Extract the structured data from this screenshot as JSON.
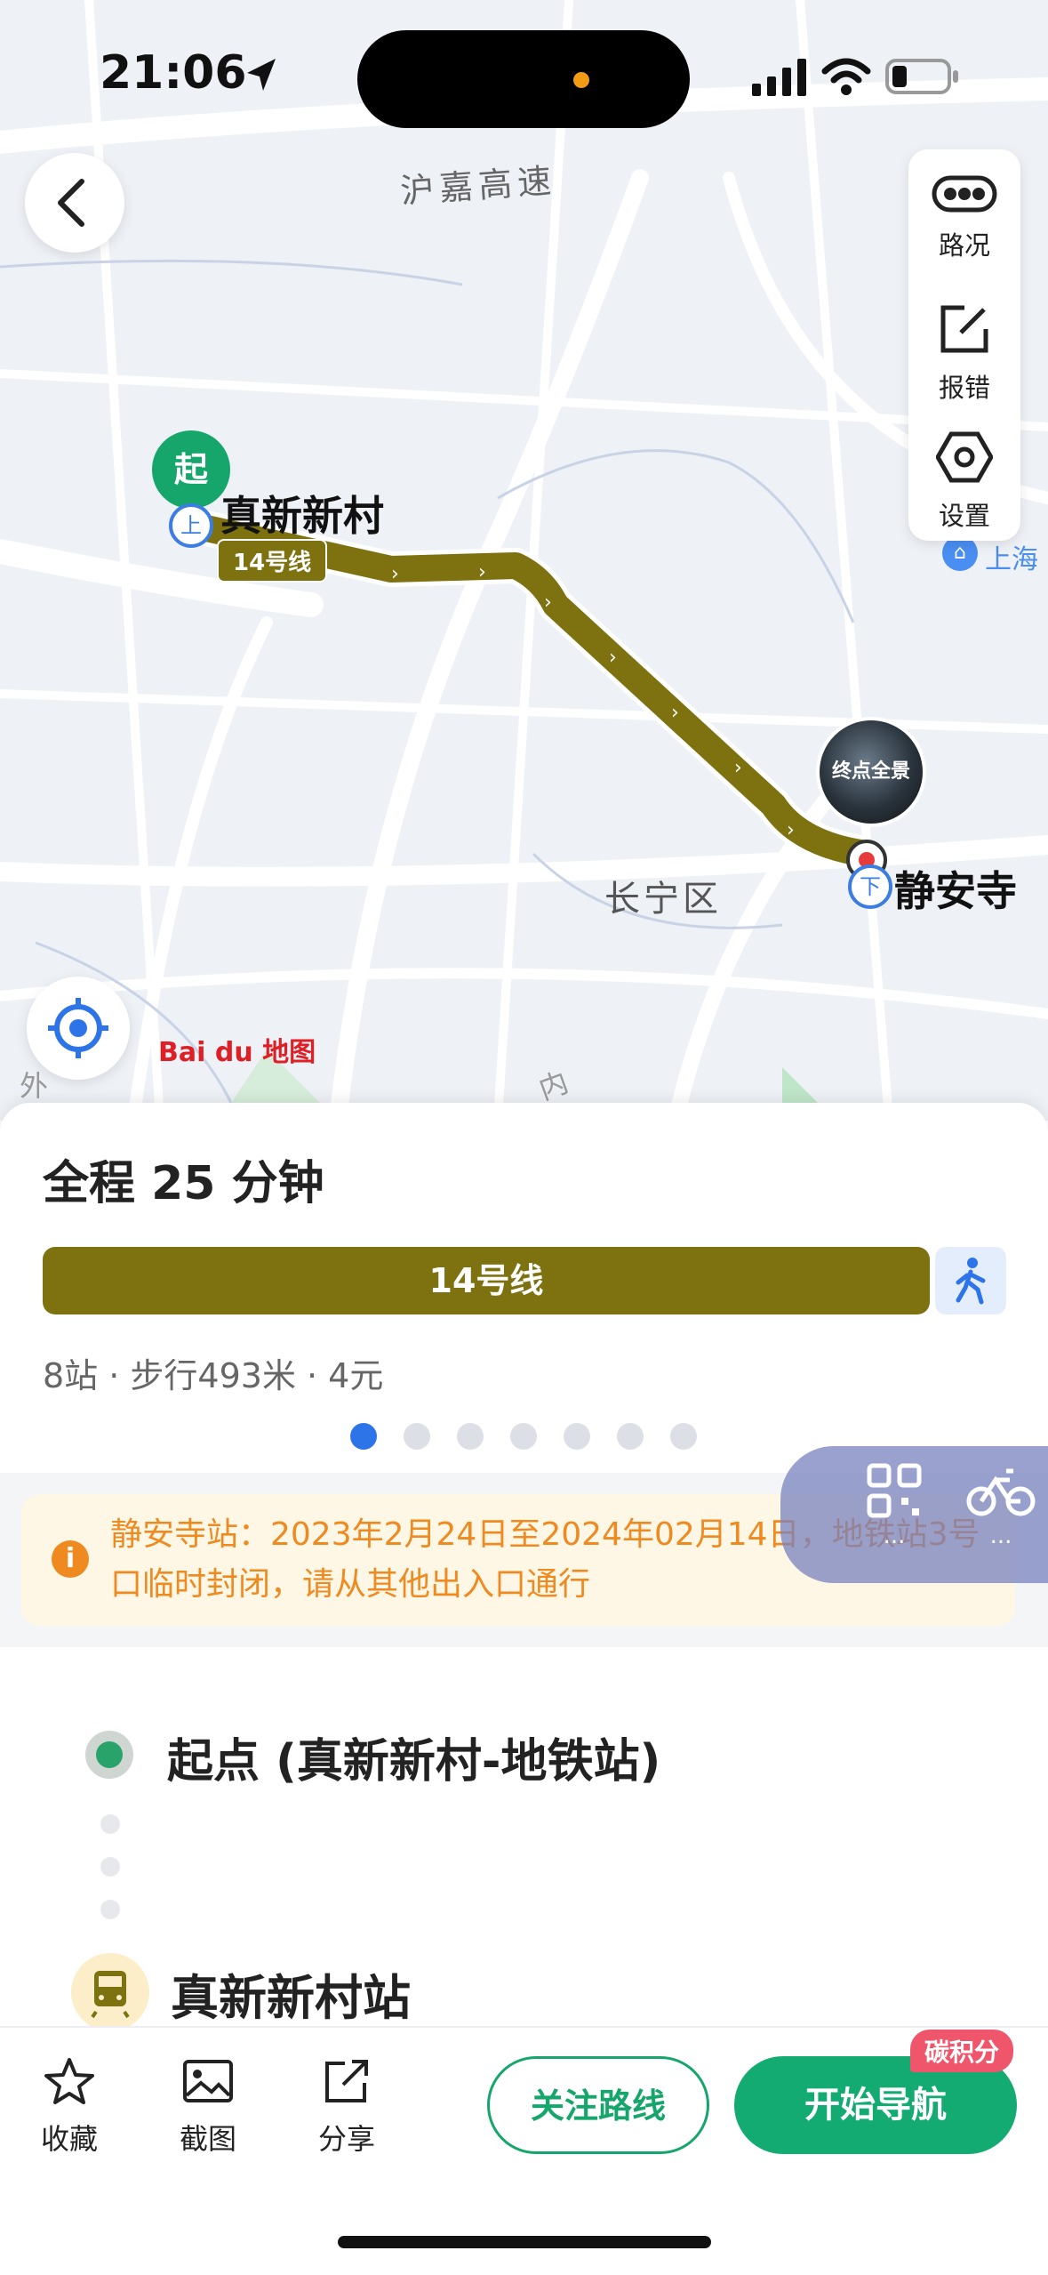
{
  "status_bar": {
    "time": "21:06"
  },
  "map": {
    "highway_label": "沪嘉高速",
    "start_station": "真新新村",
    "end_station": "静安寺",
    "district": "长宁区",
    "line_badge": "14号线",
    "start_pin": "起",
    "board_icon": "上",
    "alight_icon": "下",
    "panorama_label": "终点全景",
    "poi_label": "上海",
    "edge_label_left": "外",
    "edge_label_bottom": "内",
    "logo_text": "Bai du 地图",
    "route_color": "#7d7110"
  },
  "right_tools": [
    {
      "icon": "traffic-icon",
      "label": "路况"
    },
    {
      "icon": "report-error-icon",
      "label": "报错"
    },
    {
      "icon": "settings-icon",
      "label": "设置"
    }
  ],
  "summary": {
    "total_prefix": "全程",
    "total_minutes": "25",
    "total_suffix": "分钟",
    "line_name": "14号线",
    "meta": "8站 · 步行493米 · 4元",
    "page_count": 7,
    "active_page": 0
  },
  "notice": {
    "text": "静安寺站：2023年2月24日至2024年02月14日，地铁站3号口临时封闭，请从其他出入口通行"
  },
  "float_tools": [
    {
      "icon": "qr-code-icon",
      "label": "..."
    },
    {
      "icon": "bike-icon",
      "label": "..."
    }
  ],
  "steps": {
    "start": "起点 (真新新村-地铁站)",
    "station": "真新新村站"
  },
  "bottom_bar": {
    "favorite": "收藏",
    "screenshot": "截图",
    "share": "分享",
    "follow_route": "关注路线",
    "start_nav": "开始导航",
    "carbon_badge": "碳积分"
  }
}
